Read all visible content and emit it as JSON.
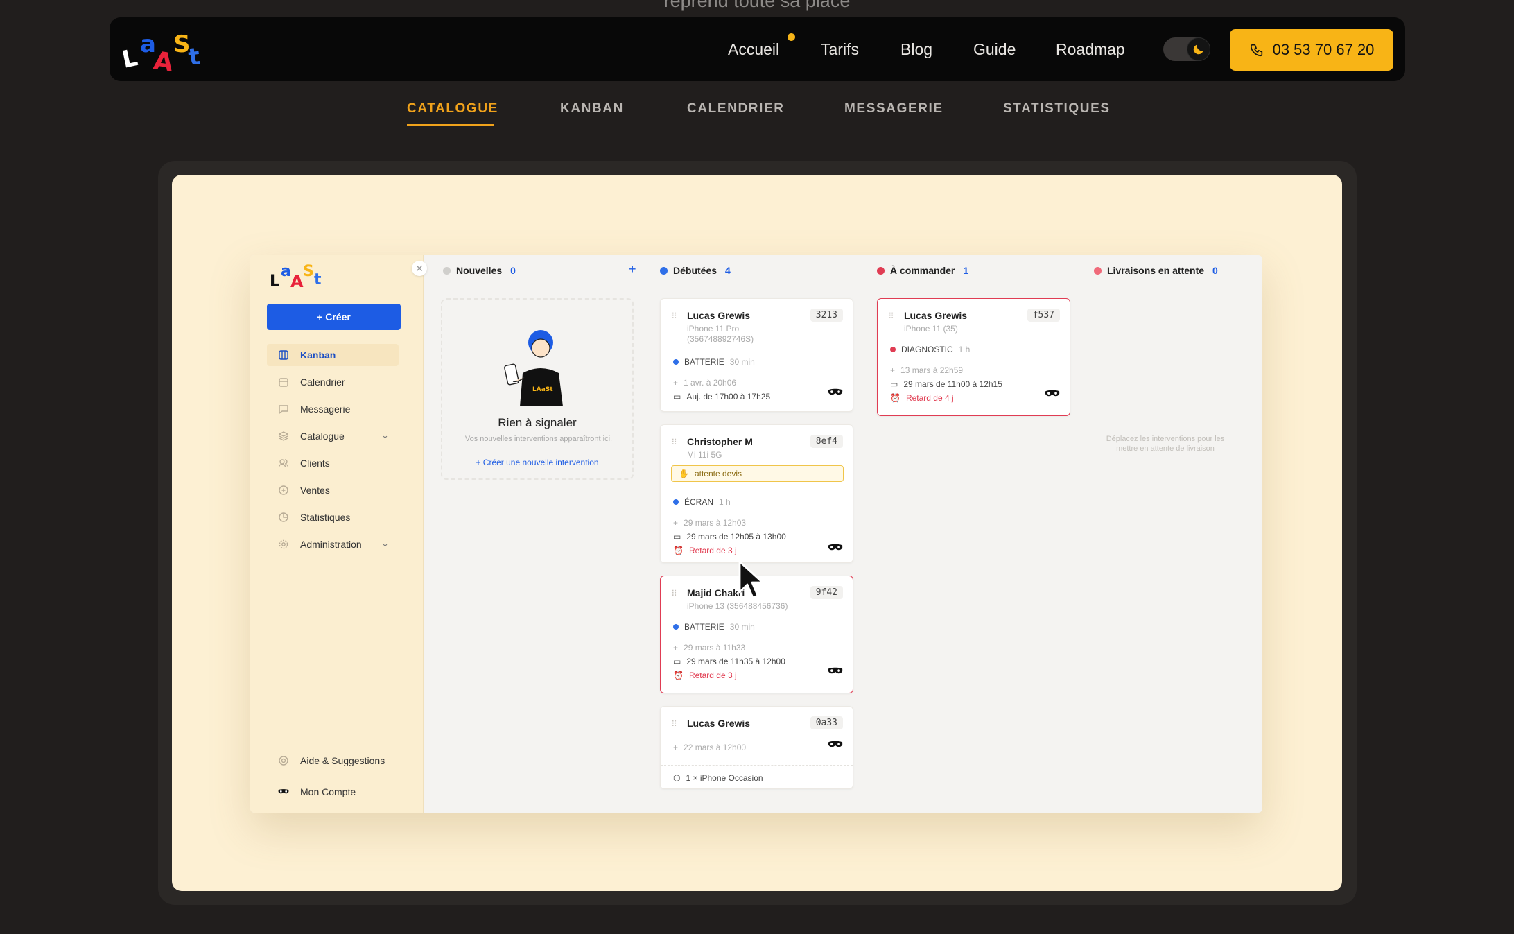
{
  "page": {
    "top_text": "reprend toute sa place"
  },
  "brand": {
    "logo_text": "LAaSt",
    "accent": "#f8b416"
  },
  "nav": {
    "links": [
      "Accueil",
      "Tarifs",
      "Blog",
      "Guide",
      "Roadmap"
    ],
    "phone": "03 53 70 67 20",
    "theme_icon": "moon-icon"
  },
  "tabs": [
    {
      "label": "CATALOGUE",
      "active": true
    },
    {
      "label": "KANBAN",
      "active": false
    },
    {
      "label": "CALENDRIER",
      "active": false
    },
    {
      "label": "MESSAGERIE",
      "active": false
    },
    {
      "label": "STATISTIQUES",
      "active": false
    }
  ],
  "app": {
    "sidebar": {
      "create_label": "+ Créer",
      "items": [
        {
          "label": "Kanban",
          "icon": "kanban-icon",
          "active": true
        },
        {
          "label": "Calendrier",
          "icon": "calendar-icon"
        },
        {
          "label": "Messagerie",
          "icon": "chat-icon"
        },
        {
          "label": "Catalogue",
          "icon": "layers-icon",
          "has_chevron": true
        },
        {
          "label": "Clients",
          "icon": "users-icon"
        },
        {
          "label": "Ventes",
          "icon": "sales-icon"
        },
        {
          "label": "Statistiques",
          "icon": "chart-icon"
        },
        {
          "label": "Administration",
          "icon": "settings-icon",
          "has_chevron": true
        }
      ],
      "footer": [
        {
          "label": "Aide & Suggestions",
          "icon": "help-icon"
        },
        {
          "label": "Mon Compte",
          "icon": "avatar-icon"
        }
      ]
    },
    "columns": [
      {
        "title": "Nouvelles",
        "count": "0",
        "color": "#d0cfcc"
      },
      {
        "title": "Débutées",
        "count": "4",
        "color": "#2f6fe8"
      },
      {
        "title": "À commander",
        "count": "1",
        "color": "#e03c53"
      },
      {
        "title": "Livraisons en attente",
        "count": "0",
        "color": "#f06a7a"
      }
    ],
    "empty": {
      "title": "Rien à signaler",
      "subtitle": "Vos nouvelles interventions apparaîtront ici.",
      "link": "+ Créer une nouvelle intervention"
    },
    "drop_hint": "Déplacez les interventions pour les mettre en attente de livraison",
    "cards": [
      {
        "name": "Lucas Grewis",
        "id": "3213",
        "device": "iPhone 11 Pro (356748892746S)",
        "task": "BATTERIE",
        "duration": "30 min",
        "created": "1 avr. à 20h06",
        "schedule": "Auj. de 17h00 à 17h25"
      },
      {
        "name": "Christopher M",
        "id": "8ef4",
        "device": "Mi 11i 5G",
        "tag": "attente devis",
        "task": "ÉCRAN",
        "duration": "1 h",
        "created": "29 mars à 12h03",
        "schedule": "29 mars de 12h05 à 13h00",
        "delay": "Retard de 3 j"
      },
      {
        "name": "Majid Chakri",
        "id": "9f42",
        "device": "iPhone 13 (356488456736)",
        "task": "BATTERIE",
        "duration": "30 min",
        "created": "29 mars à 11h33",
        "schedule": "29 mars de 11h35 à 12h00",
        "delay": "Retard de 3 j"
      },
      {
        "name": "Lucas Grewis",
        "id": "0a33",
        "created": "22 mars à 12h00",
        "item": "1 × iPhone Occasion"
      },
      {
        "name": "Lucas Grewis",
        "id": "f537",
        "device": "iPhone 11 (35)",
        "task": "DIAGNOSTIC",
        "duration": "1 h",
        "created": "13 mars à 22h59",
        "schedule": "29 mars de 11h00 à 12h15",
        "delay": "Retard de 4 j"
      }
    ]
  }
}
